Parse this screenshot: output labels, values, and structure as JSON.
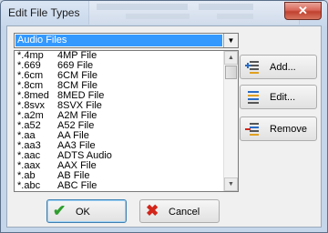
{
  "window": {
    "title": "Edit File Types",
    "close_label": "✕"
  },
  "filter": {
    "selected": "Audio Files",
    "options": [
      "Audio Files"
    ]
  },
  "file_types": [
    {
      "ext": "*.4mp",
      "desc": "4MP File"
    },
    {
      "ext": "*.669",
      "desc": "669 File"
    },
    {
      "ext": "*.6cm",
      "desc": "6CM File"
    },
    {
      "ext": "*.8cm",
      "desc": "8CM File"
    },
    {
      "ext": "*.8med",
      "desc": "8MED File"
    },
    {
      "ext": "*.8svx",
      "desc": "8SVX File"
    },
    {
      "ext": "*.a2m",
      "desc": "A2M File"
    },
    {
      "ext": "*.a52",
      "desc": "A52 File"
    },
    {
      "ext": "*.aa",
      "desc": "AA File"
    },
    {
      "ext": "*.aa3",
      "desc": "AA3 File"
    },
    {
      "ext": "*.aac",
      "desc": "ADTS Audio"
    },
    {
      "ext": "*.aax",
      "desc": "AAX File"
    },
    {
      "ext": "*.ab",
      "desc": "AB File"
    },
    {
      "ext": "*.abc",
      "desc": "ABC File"
    }
  ],
  "buttons": {
    "add": "Add...",
    "edit": "Edit...",
    "remove": "Remove",
    "ok": "OK",
    "cancel": "Cancel"
  },
  "icons": {
    "add": "list-add-icon",
    "edit": "list-edit-icon",
    "remove": "list-remove-icon",
    "ok": "green-checkmark-icon",
    "cancel": "red-x-icon"
  },
  "colors": {
    "selection": "#3399ff",
    "ok_check": "#2e9e2e",
    "cancel_x": "#d2261b"
  }
}
